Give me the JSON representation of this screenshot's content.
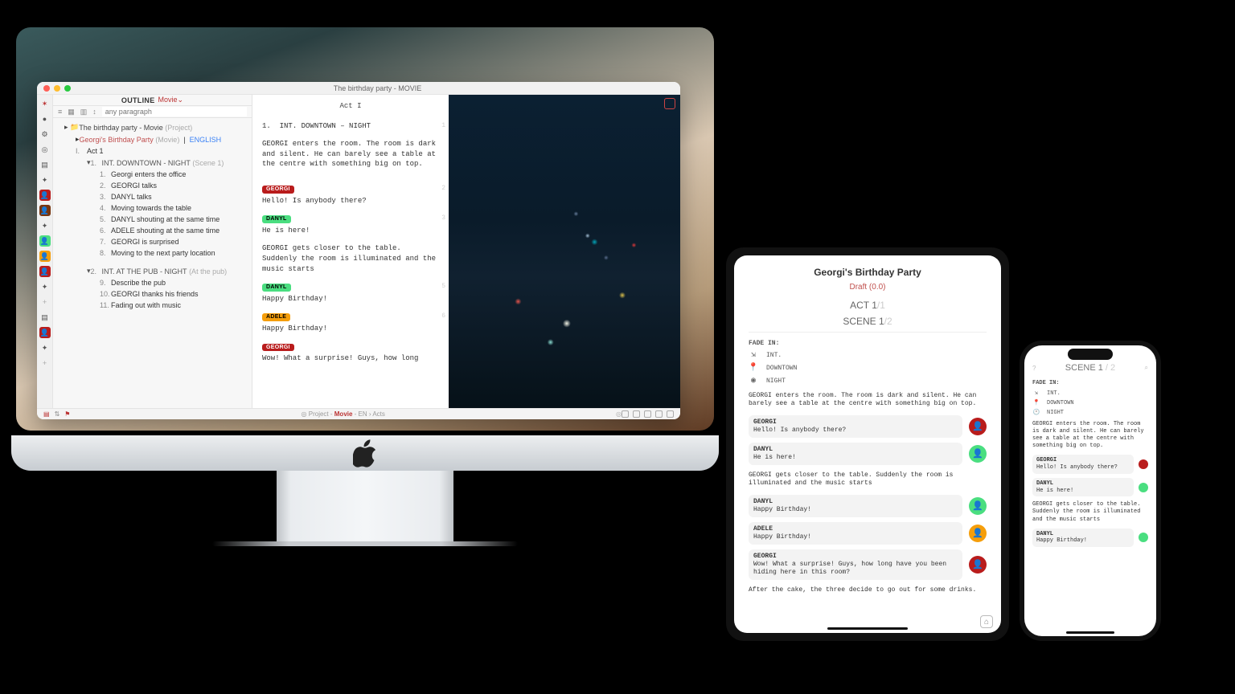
{
  "mac": {
    "window_title": "The birthday party - MOVIE",
    "outline_label": "OUTLINE",
    "mode": "Movie",
    "search_placeholder": "any paragraph",
    "project": {
      "label": "The birthday party - Movie",
      "meta": "(Project)"
    },
    "screenplay": {
      "label": "Georgi's Birthday Party",
      "meta": "(Movie)",
      "lang": "ENGLISH"
    },
    "act_label": "Act 1",
    "scenes": [
      {
        "n": "1.",
        "label": "INT. DOWNTOWN - NIGHT",
        "meta": "(Scene 1)",
        "rows": [
          {
            "n": "1.",
            "t": "Georgi enters the office"
          },
          {
            "n": "2.",
            "t": "GEORGI talks"
          },
          {
            "n": "3.",
            "t": "DANYL talks"
          },
          {
            "n": "4.",
            "t": "Moving towards the table"
          },
          {
            "n": "5.",
            "t": "DANYL shouting at the same time"
          },
          {
            "n": "6.",
            "t": "ADELE shouting at the same time"
          },
          {
            "n": "7.",
            "t": "GEORGI is surprised"
          },
          {
            "n": "8.",
            "t": "Moving to the next party location"
          }
        ]
      },
      {
        "n": "2.",
        "label": "INT. AT THE PUB - NIGHT",
        "meta": "(At the pub)",
        "rows": [
          {
            "n": "9.",
            "t": "Describe the pub"
          },
          {
            "n": "10.",
            "t": "GEORGI thanks his friends"
          },
          {
            "n": "11.",
            "t": "Fading out with music"
          }
        ]
      }
    ],
    "editor": {
      "act": "Act I",
      "slug_n": "1.",
      "slug": "INT. DOWNTOWN – NIGHT",
      "p1": "GEORGI enters the room. The room is dark and silent. He can barely see a table at the centre with something big on top.",
      "d1_name": "GEORGI",
      "d1": "Hello! Is anybody there?",
      "d2_name": "DANYL",
      "d2": "He is here!",
      "p2": "GEORGI gets closer to the table. Suddenly the room is illuminated and the music starts",
      "d3_name": "DANYL",
      "d3": "Happy Birthday!",
      "d4_name": "ADELE",
      "d4": "Happy Birthday!",
      "d5_name": "GEORGI",
      "d5": "Wow! What a surprise! Guys, how long"
    },
    "bc": {
      "a": "Project",
      "b": "Movie",
      "c": "EN",
      "d": "Acts"
    }
  },
  "ipad": {
    "title": "Georgi's Birthday Party",
    "draft": "Draft (0.0)",
    "act": "ACT 1",
    "act_total": "/1",
    "scene": "SCENE 1",
    "scene_total": "/2",
    "fade": "FADE IN:",
    "m1": "INT.",
    "m2": "DOWNTOWN",
    "m3": "NIGHT",
    "p1": "GEORGI enters the room. The room is dark and silent. He can barely see a table at the centre with something big on top.",
    "d1_n": "GEORGI",
    "d1": "Hello! Is anybody there?",
    "d2_n": "DANYL",
    "d2": "He is here!",
    "p2": "GEORGI gets closer to the table. Suddenly the room is illuminated and the music starts",
    "d3_n": "DANYL",
    "d3": "Happy Birthday!",
    "d4_n": "ADELE",
    "d4": "Happy Birthday!",
    "d5_n": "GEORGI",
    "d5": "Wow! What a surprise! Guys, how long have you been hiding here in this room?",
    "p3": "After the cake, the three decide to go out for some drinks."
  },
  "iphone": {
    "scene": "SCENE 1",
    "scene_total": " / 2",
    "fade": "FADE IN:",
    "m1": "INT.",
    "m2": "DOWNTOWN",
    "m3": "NIGHT",
    "p1": "GEORGI enters the room. The room is dark and silent. He can barely see a table at the centre with something big on top.",
    "d1_n": "GEORGI",
    "d1": "Hello! Is anybody there?",
    "d2_n": "DANYL",
    "d2": "He is here!",
    "p2": "GEORGI gets closer to the table. Suddenly the room is illuminated and the music starts",
    "d3_n": "DANYL",
    "d3": "Happy Birthday!"
  }
}
